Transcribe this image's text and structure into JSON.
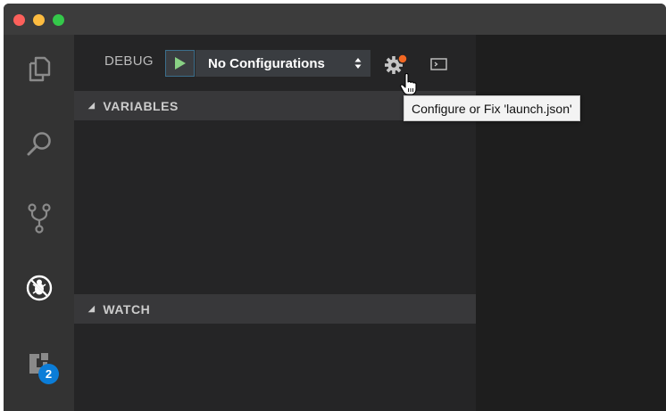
{
  "window": {
    "controls": [
      "close",
      "minimize",
      "maximize"
    ]
  },
  "activity_bar": {
    "items": [
      {
        "icon": "explorer-icon"
      },
      {
        "icon": "search-icon"
      },
      {
        "icon": "source-control-icon"
      },
      {
        "icon": "debug-icon"
      },
      {
        "icon": "extensions-icon",
        "badge": "2"
      }
    ]
  },
  "debug_toolbar": {
    "title": "DEBUG",
    "run_icon": "play-icon",
    "configuration": "No Configurations",
    "settings_icon": "gear-icon",
    "console_icon": "debug-console-icon"
  },
  "sections": {
    "variables": "VARIABLES",
    "watch": "WATCH"
  },
  "tooltip": {
    "text": "Configure or Fix 'launch.json'"
  },
  "colors": {
    "activity_bar": "#333333",
    "sidebar": "#252526",
    "editor": "#1e1e1e",
    "section_header": "#38383a",
    "play_green": "#89d185",
    "badge_blue": "#0b7dd8",
    "gear_dot": "#f26722"
  }
}
